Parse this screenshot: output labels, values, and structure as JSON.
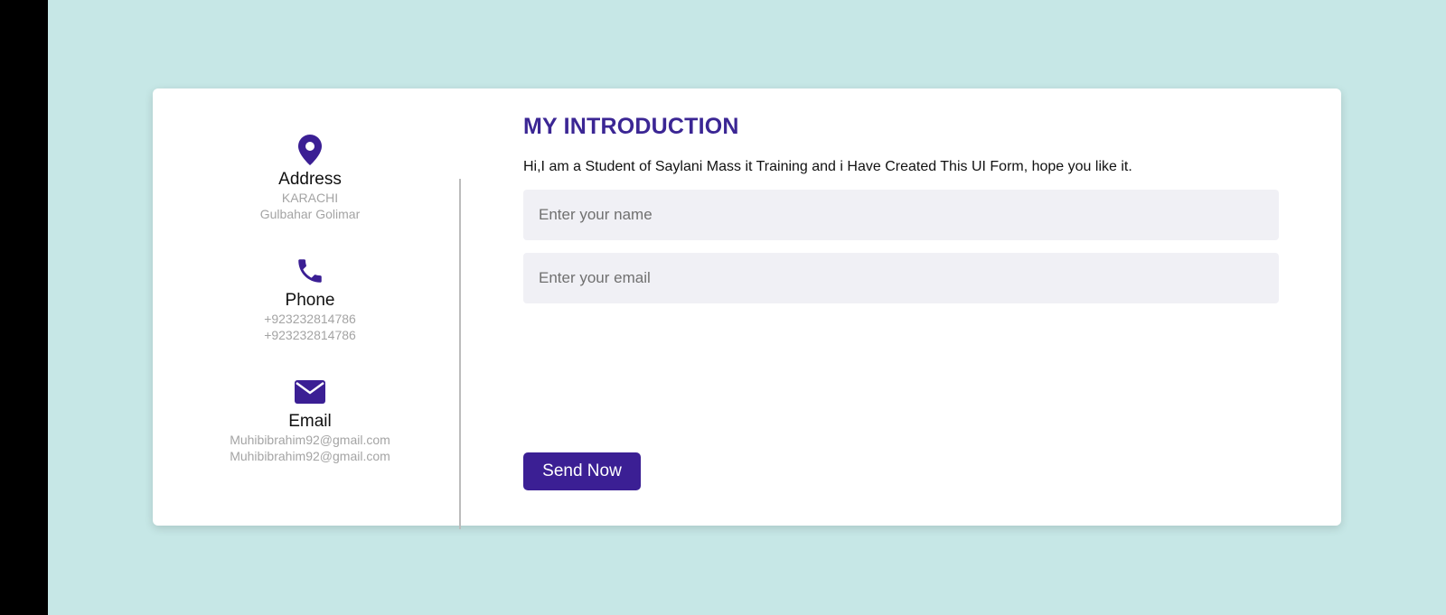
{
  "colors": {
    "background": "#c6e7e6",
    "accent": "#3b1f94",
    "card": "#ffffff",
    "input_bg": "#f0f0f5"
  },
  "contact": {
    "address": {
      "icon": "map-marker-icon",
      "label": "Address",
      "line1": "KARACHI",
      "line2": "Gulbahar Golimar"
    },
    "phone": {
      "icon": "phone-icon",
      "label": "Phone",
      "line1": "+923232814786",
      "line2": "+923232814786"
    },
    "email": {
      "icon": "envelope-icon",
      "label": "Email",
      "line1": "Muhibibrahim92@gmail.com",
      "line2": "Muhibibrahim92@gmail.com"
    }
  },
  "form": {
    "title": "MY INTRODUCTION",
    "description": "Hi,I am a Student of Saylani Mass it Training and i Have Created This UI Form, hope you like it.",
    "name_field": {
      "placeholder": "Enter your name",
      "value": ""
    },
    "email_field": {
      "placeholder": "Enter your email",
      "value": ""
    },
    "submit_label": "Send Now"
  }
}
